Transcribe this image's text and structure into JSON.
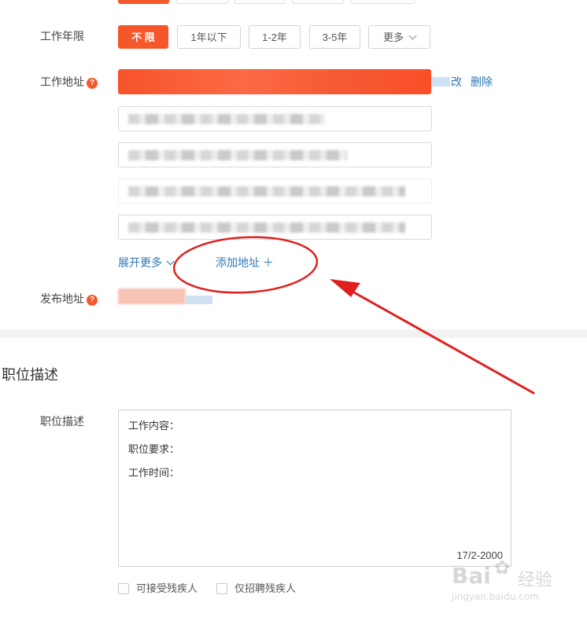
{
  "work_years": {
    "label": "工作年限",
    "options": [
      "不 限",
      "1年以下",
      "1-2年",
      "3-5年",
      "更多"
    ]
  },
  "work_address": {
    "label": "工作地址",
    "help_icon": "?",
    "edit_partial": "改",
    "delete_link": "删除",
    "expand_more": "展开更多",
    "add_address": "添加地址 ＋"
  },
  "publish_address": {
    "label": "发布地址",
    "help_icon": "?"
  },
  "job_description_section": {
    "title": "职位描述",
    "field_label": "职位描述",
    "lines": [
      "工作内容：",
      "职位要求：",
      "工作时间："
    ],
    "counter": "17/2-2000"
  },
  "checkboxes": [
    {
      "label": "可接受残疾人"
    },
    {
      "label": "仅招聘残疾人"
    }
  ],
  "watermark": {
    "brand": "Bai",
    "brand_cn": "经验",
    "url": "jingyan.baidu.com"
  },
  "colors": {
    "accent": "#f5572b",
    "link": "#2c78b8",
    "annotation": "#e02020"
  }
}
